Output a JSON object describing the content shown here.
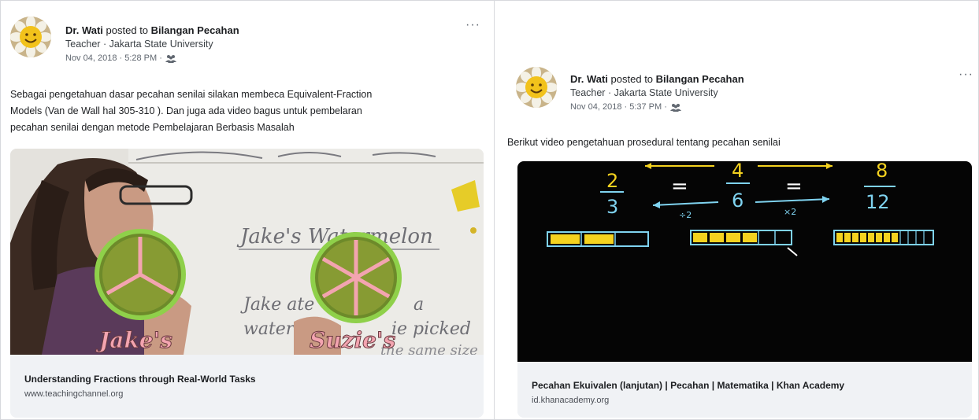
{
  "left_post": {
    "author": "Dr. Wati",
    "posted_to": "posted to",
    "group": "Bilangan Pecahan",
    "subtitle": "Teacher · Jakarta State University",
    "date": "Nov 04, 2018 · 5:28 PM ·",
    "more": "···",
    "text_line1": "Sebagai pengetahuan dasar pecahan senilai silakan membeca Equivalent-Fraction",
    "text_line2": "Models (Van de Wall hal  305-310 ). Dan juga ada video bagus untuk pembelaran",
    "text_line3": "pecahan senilai dengan metode Pembelajaran Berbasis Masalah",
    "image_labels": {
      "board_title": "Jake's Watermelon",
      "board_line1": "Jake ate",
      "board_line1b": "a",
      "board_line2": "waterm",
      "board_line2b": "ie picked",
      "board_line3": "the same size",
      "left_name": "Jake's",
      "right_name": "Suzie's"
    },
    "link_title": "Understanding Fractions through Real-World Tasks",
    "link_domain": "www.teachingchannel.org"
  },
  "right_post": {
    "author": "Dr. Wati",
    "posted_to": "posted to",
    "group": "Bilangan Pecahan",
    "subtitle": "Teacher · Jakarta State University",
    "date": "Nov 04, 2018 · 5:37 PM ·",
    "more": "···",
    "text_line1": "Berikut video pengetahuan prosedural tentang pecahan senilai",
    "image_labels": {
      "frac1_num": "2",
      "frac1_den": "3",
      "equals1": "=",
      "frac2_num": "4",
      "frac2_den": "6",
      "equals2": "=",
      "frac3_num": "8",
      "frac3_den": "12",
      "div_label": "÷2",
      "mult_label": "×2"
    },
    "link_title": "Pecahan Ekuivalen (lanjutan) | Pecahan | Matematika | Khan Academy",
    "link_domain": "id.khanacademy.org"
  },
  "colors": {
    "chalk_blue": "#7fd3f0",
    "chalk_yellow": "#f4d21f",
    "name_pink": "#f3a4b0",
    "card_bg": "#f0f2f5"
  }
}
